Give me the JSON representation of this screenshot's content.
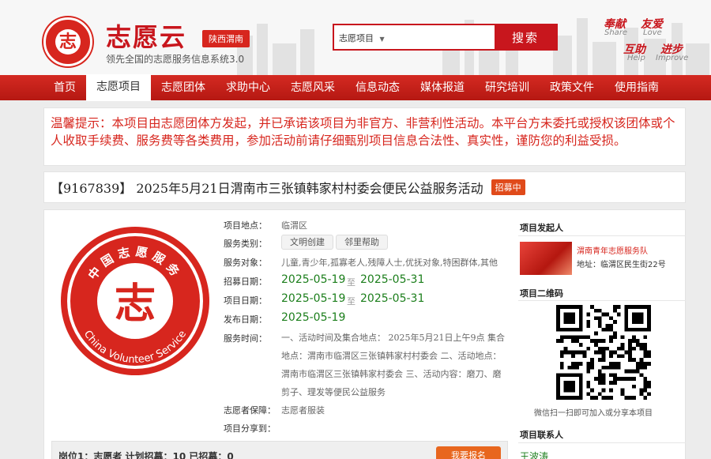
{
  "header": {
    "site_name": "志愿云",
    "tagline": "领先全国的志愿服务信息系统3.0",
    "region": "陕西渭南",
    "logo_glyph": "志",
    "search": {
      "category": "志愿项目",
      "button": "搜索"
    },
    "slogans": [
      {
        "cn": "奉献",
        "en": "Share"
      },
      {
        "cn": "友爱",
        "en": "Love"
      },
      {
        "cn": "互助",
        "en": "Help"
      },
      {
        "cn": "进步",
        "en": "Improve"
      }
    ]
  },
  "nav": {
    "items": [
      "首页",
      "志愿项目",
      "志愿团体",
      "求助中心",
      "志愿风采",
      "信息动态",
      "媒体报道",
      "研究培训",
      "政策文件",
      "使用指南"
    ],
    "active_index": 1
  },
  "notice": "温馨提示：本项目由志愿团体方发起，并已承诺该项目为非官方、非营利性活动。本平台方未委托或授权该团体或个人收取手续费、服务费等各类费用，参加活动前请仔细甄别项目信息合法性、真实性，谨防您的利益受损。",
  "project": {
    "title": "【9167839】 2025年5月21日渭南市三张镇韩家村村委会便民公益服务活动",
    "status": "招募中",
    "logo_text_cn": "中国志愿服务",
    "logo_text_en": "China Volunteer Service",
    "fields": {
      "location_label": "项目地点：",
      "location": "临渭区",
      "category_label": "服务类别：",
      "categories": [
        "文明创建",
        "邻里帮助"
      ],
      "target_label": "服务对象：",
      "target": "儿童,青少年,孤寡老人,残障人士,优抚对象,特困群体,其他",
      "recruit_label": "招募日期：",
      "recruit_start": "2025-05-19",
      "recruit_end": "2025-05-31",
      "project_label": "项目日期：",
      "project_start": "2025-05-19",
      "project_end": "2025-05-31",
      "publish_label": "发布日期：",
      "publish_date": "2025-05-19",
      "date_sep": "至",
      "time_label": "服务时间：",
      "time_desc": "一、活动时间及集合地点： 2025年5月21日上午9点 集合地点：渭南市临渭区三张镇韩家村村委会 二、活动地点：渭南市临渭区三张镇韩家村委会 三、活动内容：磨刀、磨剪子、理发等便民公益服务",
      "guarantee_label": "志愿者保障：",
      "guarantee": "志愿者服装",
      "share_label": "项目分享到："
    },
    "post": {
      "text": "岗位1：志愿者   计划招募：10   已招募：0",
      "button": "我要报名"
    }
  },
  "sidebar": {
    "initiator_head": "项目发起人",
    "org_name": "渭南青年志愿服务队",
    "org_address": "地址：临渭区民生街22号",
    "qr_head": "项目二维码",
    "qr_caption": "微信扫一扫即可加入或分享本项目",
    "contact_head": "项目联系人",
    "contact_name": "王波涛"
  },
  "colors": {
    "brand": "#c8161d",
    "date_green": "#1b7e1b",
    "badge_orange": "#e04a1a"
  }
}
